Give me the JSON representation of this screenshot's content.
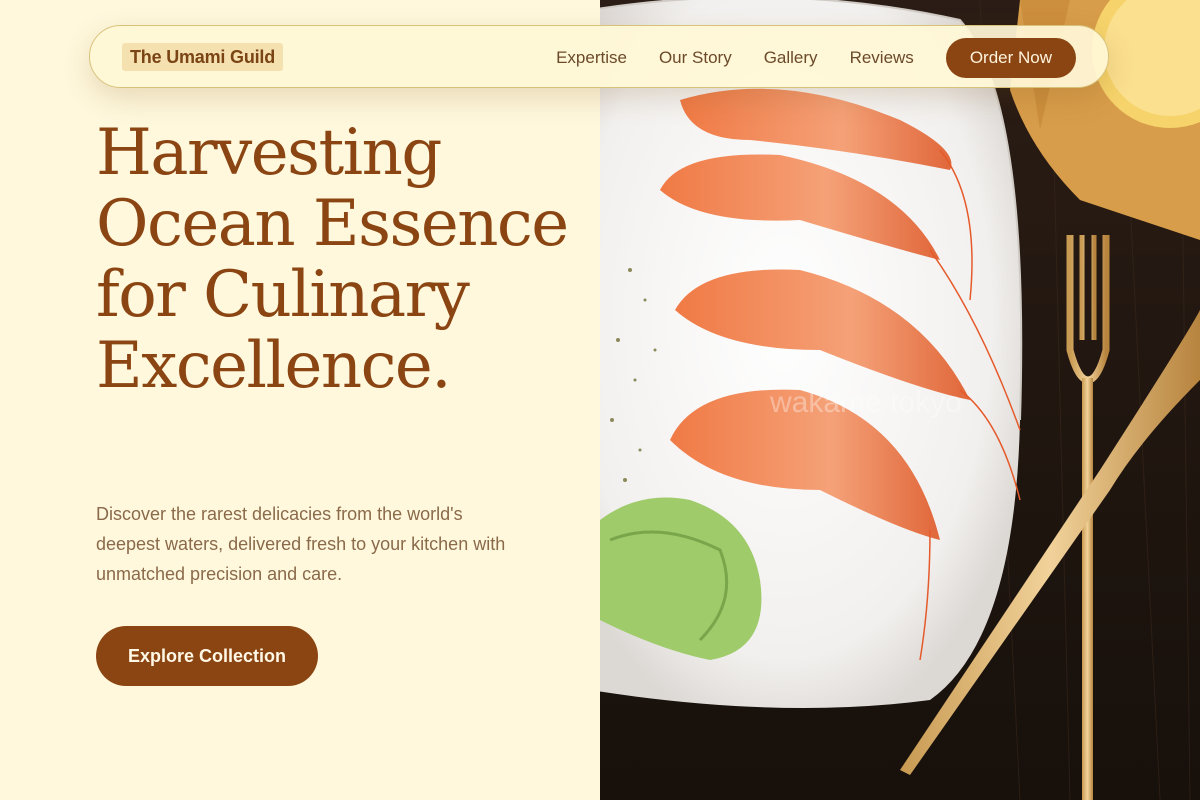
{
  "nav": {
    "brand": "The Umami Guild",
    "links": [
      "Expertise",
      "Our Story",
      "Gallery",
      "Reviews"
    ],
    "cta": "Order Now"
  },
  "hero": {
    "headline": "Harvesting Ocean Essence for Culinary Excellence.",
    "subtext": "Discover the rarest delicacies from the world's deepest waters, delivered fresh to your kitchen with unmatched precision and care.",
    "cta": "Explore Collection"
  },
  "image": {
    "watermark": "wakame tokyo"
  },
  "colors": {
    "accent": "#8b4513",
    "background": "#fff8dc",
    "body_text": "#8a6a4a"
  }
}
